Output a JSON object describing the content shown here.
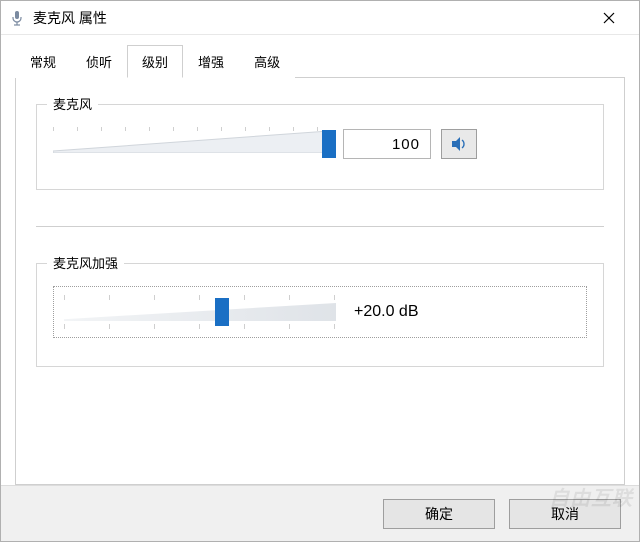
{
  "window": {
    "title": "麦克风 属性"
  },
  "tabs": {
    "items": [
      {
        "label": "常规",
        "active": false
      },
      {
        "label": "侦听",
        "active": false
      },
      {
        "label": "级别",
        "active": true
      },
      {
        "label": "增强",
        "active": false
      },
      {
        "label": "高级",
        "active": false
      }
    ]
  },
  "mic_level": {
    "legend": "麦克风",
    "value_text": "100",
    "percent": 100,
    "speaker_icon": "speaker-icon"
  },
  "mic_boost": {
    "legend": "麦克风加强",
    "value_text": "+20.0 dB",
    "position_percent": 58
  },
  "footer": {
    "ok": "确定",
    "cancel": "取消"
  },
  "watermark": "自由互联",
  "colors": {
    "accent": "#1a6fc4"
  }
}
